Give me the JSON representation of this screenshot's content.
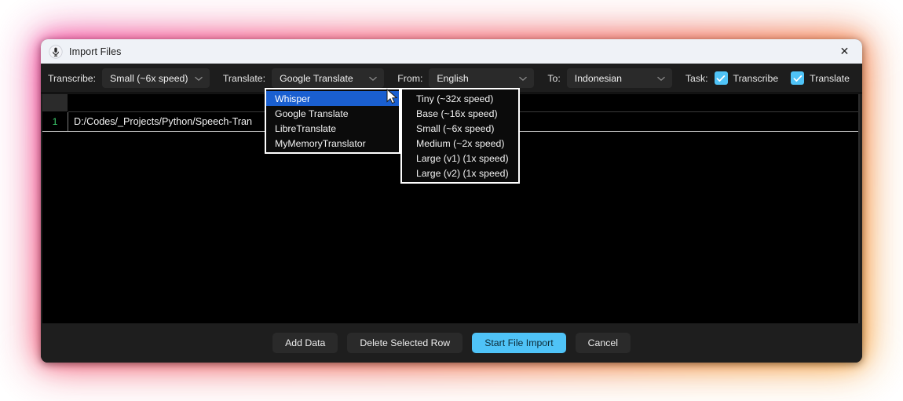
{
  "window": {
    "title": "Import Files",
    "icon": "microphone-icon",
    "close_label": "✕"
  },
  "toolbar": {
    "transcribe_label": "Transcribe:",
    "transcribe_value": "Small (~6x speed)",
    "translate_label": "Translate:",
    "translate_value": "Google Translate",
    "from_label": "From:",
    "from_value": "English",
    "to_label": "To:",
    "to_value": "Indonesian",
    "task_label": "Task:",
    "task_transcribe": "Transcribe",
    "task_translate": "Translate",
    "task_transcribe_checked": true,
    "task_translate_checked": true,
    "accent_color": "#4fc3f7"
  },
  "menus": {
    "translate_engine": {
      "items": [
        "Whisper",
        "Google Translate",
        "LibreTranslate",
        "MyMemoryTranslator"
      ],
      "selected_index": 0,
      "highlight_color": "#1a5fd0"
    },
    "whisper_model": {
      "items": [
        "Tiny (~32x speed)",
        "Base (~16x speed)",
        "Small (~6x speed)",
        "Medium (~2x speed)",
        "Large (v1) (1x speed)",
        "Large (v2) (1x speed)"
      ]
    }
  },
  "table": {
    "rows": [
      {
        "number": "1",
        "path": "D:/Codes/_Projects/Python/Speech-Tran"
      }
    ]
  },
  "footer": {
    "add_data": "Add Data",
    "delete_selected_row": "Delete Selected Row",
    "start_file_import": "Start File Import",
    "cancel": "Cancel"
  }
}
